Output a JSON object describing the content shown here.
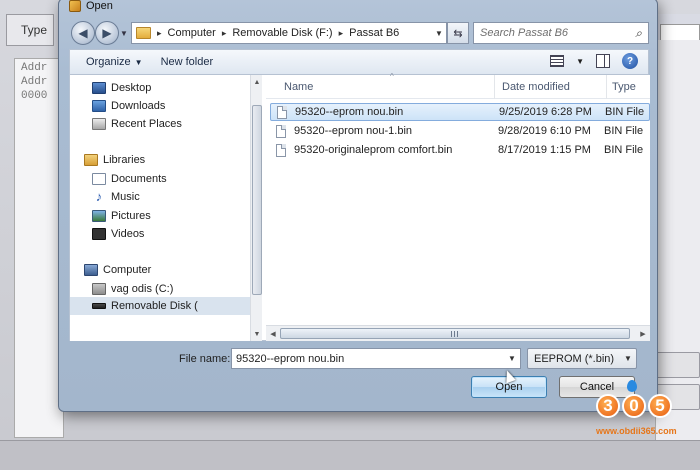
{
  "background": {
    "type_label": "Type",
    "hex_rows": [
      "Addr",
      "Addr",
      "0000"
    ]
  },
  "dialog": {
    "title": "Open",
    "address": {
      "crumbs": [
        "Computer",
        "Removable Disk (F:)",
        "Passat B6"
      ]
    },
    "search": {
      "placeholder": "Search Passat B6"
    },
    "toolbar": {
      "organize_label": "Organize",
      "new_folder_label": "New folder"
    },
    "nav": {
      "favorites": [
        "Desktop",
        "Downloads",
        "Recent Places"
      ],
      "libraries_label": "Libraries",
      "libraries": [
        "Documents",
        "Music",
        "Pictures",
        "Videos"
      ],
      "computer_label": "Computer",
      "drives": [
        "vag odis (C:)",
        "Removable Disk ("
      ]
    },
    "columns": {
      "name": "Name",
      "date": "Date modified",
      "type": "Type"
    },
    "files": [
      {
        "name": "95320--eprom nou.bin",
        "date": "9/25/2019 6:28 PM",
        "type": "BIN File",
        "selected": true
      },
      {
        "name": "95320--eprom nou-1.bin",
        "date": "9/28/2019 6:10 PM",
        "type": "BIN File",
        "selected": false
      },
      {
        "name": "95320-originaleprom comfort.bin",
        "date": "8/17/2019 1:15 PM",
        "type": "BIN File",
        "selected": false
      }
    ],
    "file_name_label": "File name:",
    "file_name_value": "95320--eprom nou.bin",
    "filter_value": "EEPROM (*.bin)",
    "open_label": "Open",
    "cancel_label": "Cancel"
  },
  "watermark": {
    "digits": [
      "3",
      "0",
      "5"
    ],
    "url": "www.obdii365.com"
  }
}
